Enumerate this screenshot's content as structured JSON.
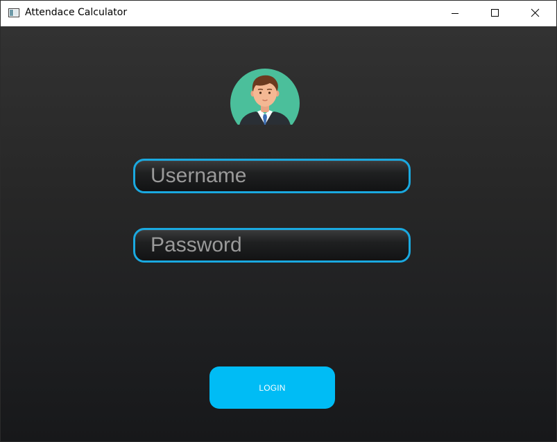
{
  "window": {
    "title": "Attendace Calculator"
  },
  "icons": {
    "app": "app-window-icon",
    "minimize": "minimize-icon",
    "maximize": "maximize-icon",
    "close": "close-icon",
    "avatar": "user-avatar-icon"
  },
  "login_form": {
    "username": {
      "value": "",
      "placeholder": "Username"
    },
    "password": {
      "value": "",
      "placeholder": "Password"
    },
    "login_label": "LOGIN"
  },
  "colors": {
    "accent": "#1aa9e0",
    "button": "#00bcf5",
    "avatar_bg": "#4bbf9b",
    "background_top": "#323232",
    "background_bottom": "#17181a"
  }
}
